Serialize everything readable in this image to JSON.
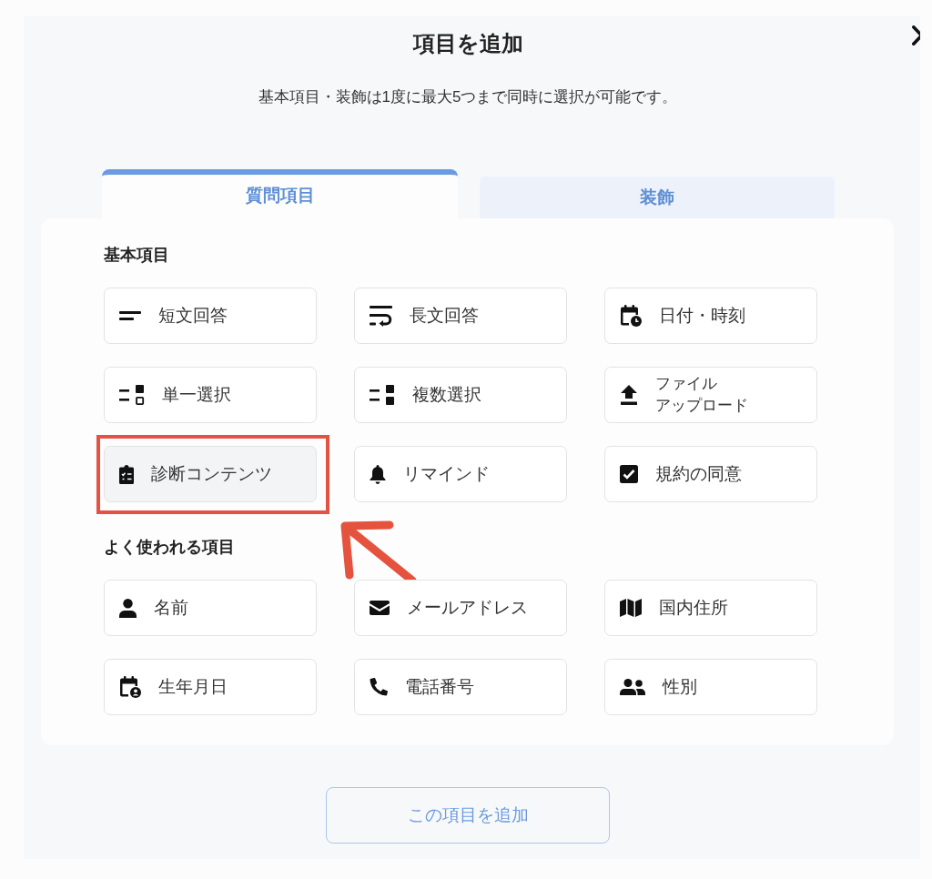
{
  "dialog": {
    "title": "項目を追加",
    "description": "基本項目・装飾は1度に最大5つまで同時に選択が可能です。"
  },
  "tabs": [
    {
      "label": "質問項目",
      "selected": true
    },
    {
      "label": "装飾",
      "selected": false
    }
  ],
  "sections": [
    {
      "heading": "基本項目",
      "items": [
        {
          "kind": "short_text",
          "label": "短文回答",
          "selected": false,
          "highlighted": false
        },
        {
          "kind": "long_text",
          "label": "長文回答",
          "selected": false,
          "highlighted": false
        },
        {
          "kind": "datetime",
          "label": "日付・時刻",
          "selected": false,
          "highlighted": false
        },
        {
          "kind": "single_choice",
          "label": "単一選択",
          "selected": false,
          "highlighted": false
        },
        {
          "kind": "multiple_choice",
          "label": "複数選択",
          "selected": false,
          "highlighted": false
        },
        {
          "kind": "file_upload",
          "label_lines": [
            "ファイル",
            "アップロード"
          ],
          "selected": false,
          "highlighted": false
        },
        {
          "kind": "diagnosis",
          "label": "診断コンテンツ",
          "selected": true,
          "highlighted": true
        },
        {
          "kind": "reminder",
          "label": "リマインド",
          "selected": false,
          "highlighted": false
        },
        {
          "kind": "agreement",
          "label": "規約の同意",
          "selected": false,
          "highlighted": false
        }
      ]
    },
    {
      "heading": "よく使われる項目",
      "items": [
        {
          "kind": "name",
          "label": "名前",
          "selected": false,
          "highlighted": false
        },
        {
          "kind": "email",
          "label": "メールアドレス",
          "selected": false,
          "highlighted": false
        },
        {
          "kind": "address",
          "label": "国内住所",
          "selected": false,
          "highlighted": false
        },
        {
          "kind": "birthdate",
          "label": "生年月日",
          "selected": false,
          "highlighted": false
        },
        {
          "kind": "phone",
          "label": "電話番号",
          "selected": false,
          "highlighted": false
        },
        {
          "kind": "gender",
          "label": "性別",
          "selected": false,
          "highlighted": false
        }
      ]
    }
  ],
  "add_button": {
    "label": "この項目を追加"
  }
}
